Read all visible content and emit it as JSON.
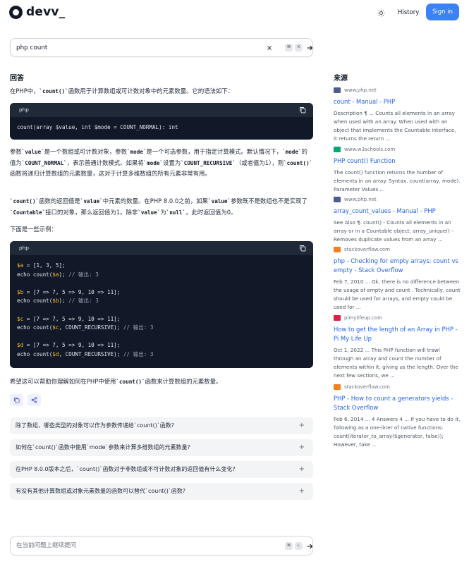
{
  "header": {
    "logo_text": "devv_",
    "history_label": "History",
    "signin_label": "Sign in"
  },
  "search": {
    "value": "php count",
    "kbd_1": "⌘",
    "kbd_2": "K"
  },
  "answer": {
    "heading": "回答",
    "p1_a": "在PHP中，",
    "p1_code": "`count()`",
    "p1_b": "函数用于计算数组或可计数对象中的元素数量。它的语法如下：",
    "code1_lang": "php",
    "code1_line": "count(array $value, int $mode = COUNT_NORMAL): int",
    "p2_a": "参数",
    "p2_c1": "`value`",
    "p2_b": "是一个数组或可计数对象，参数",
    "p2_c2": "`mode`",
    "p2_c": "是一个可选参数，用于指定计算模式。默认情况下，",
    "p2_c3": "`mode`",
    "p2_d": "的值为",
    "p2_c4": "`COUNT_NORMAL`",
    "p2_e": "，表示普通计数模式。如果将",
    "p2_c5": "`mode`",
    "p2_f": "设置为",
    "p2_c6": "`COUNT_RECURSIVE`",
    "p2_g": "（或者值为1），则",
    "p2_c7": "`count()`",
    "p2_h": "函数将递归计算数组的元素数量，这对于计算多维数组的所有元素非常有用。",
    "p3_c1": "`count()`",
    "p3_a": "函数的返回值是",
    "p3_c2": "`value`",
    "p3_b": "中元素的数量。在PHP 8.0.0之前，如果",
    "p3_c3": "`value`",
    "p3_c": "参数既不是数组也不是实现了",
    "p3_c4": "`Countable`",
    "p3_d": "接口的对象，那么返回值为1。除非",
    "p3_c5": "`value`",
    "p3_e": "为",
    "p3_c6": "`null`",
    "p3_f": "，此时返回值为0。",
    "p4": "下面是一些示例：",
    "code2_lang": "php",
    "code2_lines": [
      "$a = [1, 3, 5];",
      "echo count($a); // 输出: 3",
      "",
      "$b = [7 => 7, 5 => 9, 10 => 11];",
      "echo count($b); // 输出: 3",
      "",
      "$c = [7 => 7, 5 => 9, 10 => 11];",
      "echo count($c, COUNT_RECURSIVE); // 输出: 3",
      "",
      "$d = [7 => 7, 5 => 9, 10 => 11];",
      "echo count($d, COUNT_RECURSIVE); // 输出: 3"
    ],
    "p5_a": "希望这可以帮助你理解如何在PHP中使用",
    "p5_code": "`count()`",
    "p5_b": "函数来计算数组的元素数量。"
  },
  "suggestions": [
    "除了数组，哪些类型的对象可以作为参数传递给`count()`函数?",
    "如何在`count()`函数中使用`mode`参数来计算多维数组的元素数量?",
    "在PHP 8.0.0版本之后，`count()`函数对于非数组或不可计数对象的返回值有什么变化?",
    "有没有其他计算数组或对象元素数量的函数可以替代`count()`函数?"
  ],
  "suggestion_plus": "+",
  "followup": {
    "placeholder": "在当前问题上继续提问",
    "kbd_1": "⌘",
    "kbd_2": "L"
  },
  "sources": {
    "heading": "来源",
    "items": [
      {
        "domain": "www.php.net",
        "favicon_color": "#4f5b93",
        "title": "count - Manual - PHP",
        "snippet": "Description ¶ ... Counts all elements in an array when used with an array. When used with an object that implements the Countable interface, it returns the return ..."
      },
      {
        "domain": "www.w3schools.com",
        "favicon_color": "#04aa6d",
        "title": "PHP count() Function",
        "snippet": "The count() function returns the number of elements in an array. Syntax. count(array, mode). Parameter Values ..."
      },
      {
        "domain": "www.php.net",
        "favicon_color": "#4f5b93",
        "title": "array_count_values - Manual - PHP",
        "snippet": "See Also ¶. count() - Counts all elements in an array or in a Countable object; array_unique() - Removes duplicate values from an array ..."
      },
      {
        "domain": "stackoverflow.com",
        "favicon_color": "#f48024",
        "title": "php - Checking for empty arrays: count vs empty - Stack Overflow",
        "snippet": "Feb 7, 2010 ... Ok, there is no difference between the usage of empty and count . Technically, count should be used for arrays, and empty could be used for ..."
      },
      {
        "domain": "pimylifeup.com",
        "favicon_color": "#e11d48",
        "title": "How to get the length of an Array in PHP - Pi My Life Up",
        "snippet": "Oct 1, 2022 ... This PHP function will trawl through an array and count the number of elements within it, giving us the length. Over the next few sections, we ..."
      },
      {
        "domain": "stackoverflow.com",
        "favicon_color": "#f48024",
        "title": "PHP - How to count a generators yields - Stack Overflow",
        "snippet": "Feb 6, 2014 ... 4 Answers 4 ... If you have to do it, following as a one-liner of native functions: count(iterator_to_array($generator, false)); However, take ..."
      }
    ]
  }
}
